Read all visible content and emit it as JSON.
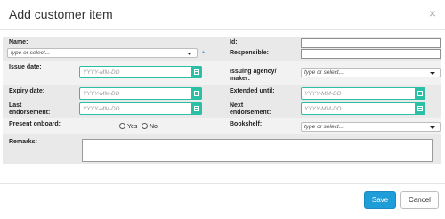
{
  "modal": {
    "title": "Add customer item",
    "close_glyph": "×"
  },
  "fields": {
    "name_label": "Name:",
    "name_placeholder": "type or select...",
    "name_required": "*",
    "id_label": "Id:",
    "id_value": "",
    "responsible_label": "Responsible:",
    "responsible_value": "",
    "issue_date_label": "Issue date:",
    "issue_date_placeholder": "YYYY-MM-DD",
    "issuing_agency_label": "Issuing agency/ maker:",
    "issuing_agency_placeholder": "type or select...",
    "expiry_date_label": "Expiry date:",
    "expiry_date_placeholder": "YYYY-MM-DD",
    "extended_until_label": "Extended until:",
    "extended_until_placeholder": "YYYY-MM-DD",
    "last_endorsement_label": "Last endorsement:",
    "last_endorsement_placeholder": "YYYY-MM-DD",
    "next_endorsement_label": "Next endorsement:",
    "next_endorsement_placeholder": "YYYY-MM-DD",
    "present_onboard_label": "Present onboard:",
    "present_onboard_options": [
      "Yes",
      "No"
    ],
    "bookshelf_label": "Bookshelf:",
    "bookshelf_placeholder": "type or select...",
    "remarks_label": "Remarks:",
    "remarks_value": ""
  },
  "actions": {
    "save_label": "Save",
    "cancel_label": "Cancel"
  },
  "colors": {
    "accent_teal": "#2bbfa5",
    "primary_blue": "#1f9dd9",
    "required_star": "#2b8fd6"
  }
}
